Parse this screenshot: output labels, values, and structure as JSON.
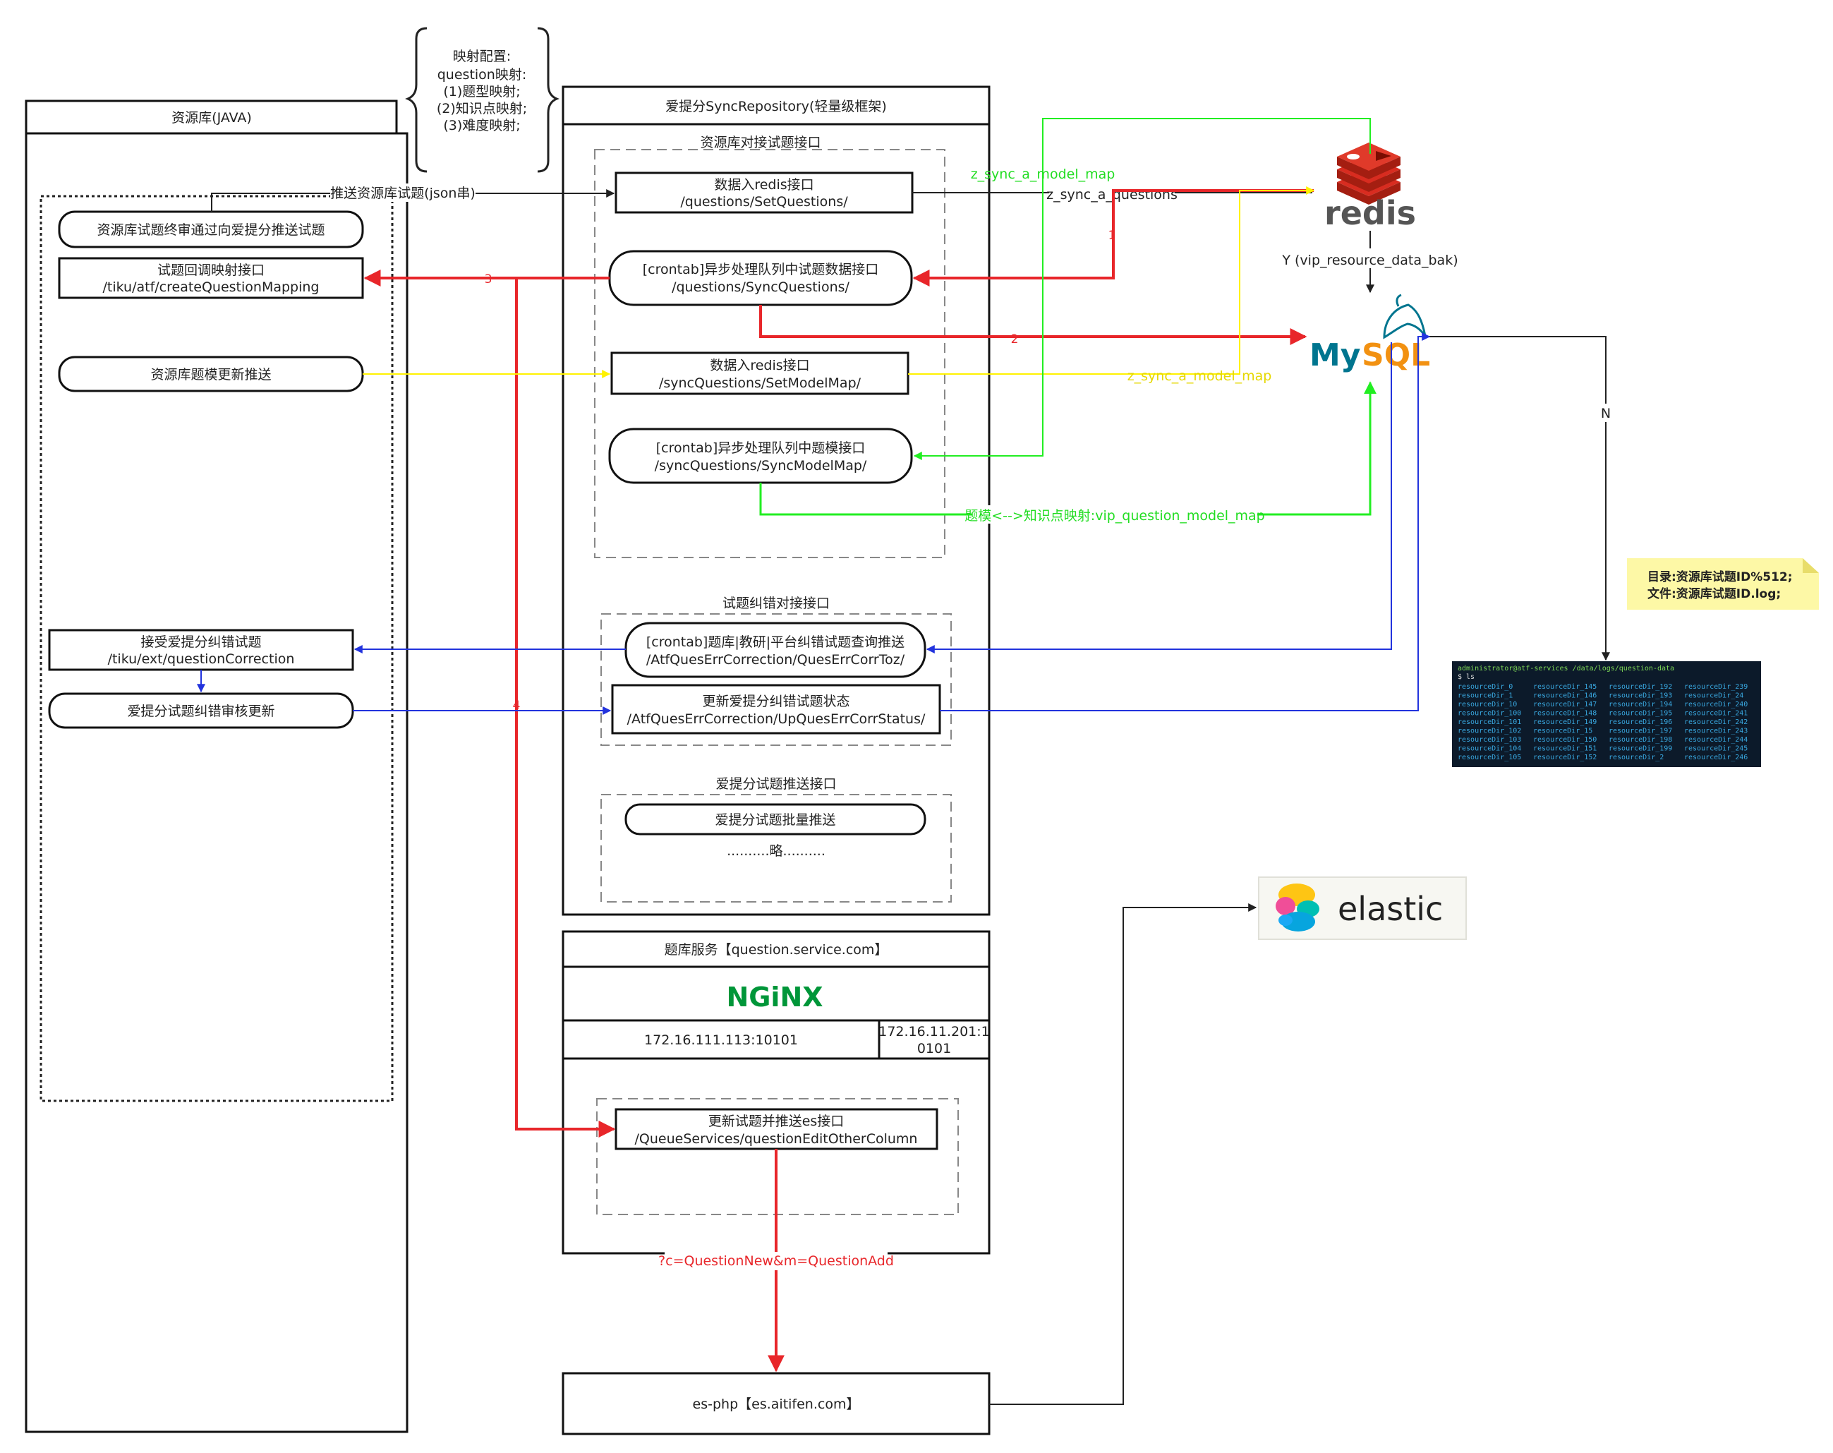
{
  "left_panel": {
    "title": "资源库(JAVA)"
  },
  "mapping_note": {
    "title": "映射配置:",
    "lines": [
      "question映射:",
      "(1)题型映射;",
      "(2)知识点映射;",
      "(3)难度映射;"
    ]
  },
  "left_nodes": {
    "review_push": "资源库试题终审通过向爱提分推送试题",
    "callback_l1": "试题回调映射接口",
    "callback_l2": "/tiku/atf/createQuestionMapping",
    "template_push": "资源库题模更新推送",
    "accept_l1": "接受爱提分纠错试题",
    "accept_l2": "/tiku/ext/questionCorrection",
    "audit_update": "爱提分试题纠错审核更新"
  },
  "sync_repo": {
    "title": "爱提分SyncRepository(轻量级框架)",
    "group1_title": "资源库对接试题接口",
    "n1_l1": "数据入redis接口",
    "n1_l2": "/questions/SetQuestions/",
    "n2_l1": "[crontab]异步处理队列中试题数据接口",
    "n2_l2": "/questions/SyncQuestions/",
    "n3_l1": "数据入redis接口",
    "n3_l2": "/syncQuestions/SetModelMap/",
    "n4_l1": "[crontab]异步处理队列中题模接口",
    "n4_l2": "/syncQuestions/SyncModelMap/",
    "group2_title": "试题纠错对接接口",
    "n5_l1": "[crontab]题库|教研|平台纠错试题查询推送",
    "n5_l2": "/AtfQuesErrCorrection/QuesErrCorrToz/",
    "n6_l1": "更新爱提分纠错试题状态",
    "n6_l2": "/AtfQuesErrCorrection/UpQuesErrCorrStatus/",
    "group3_title": "爱提分试题推送接口",
    "n7": "爱提分试题批量推送",
    "omitted": "..........略.........."
  },
  "qservice": {
    "title": "题库服务【question.service.com】",
    "nginx": "NGiNX",
    "ip1": "172.16.111.113:10101",
    "ip2_l1": "172.16.11.201:1",
    "ip2_l2": "0101",
    "n8_l1": "更新试题并推送es接口",
    "n8_l2": "/QueueServices/questionEditOtherColumn"
  },
  "es_php": {
    "label": "es-php【es.aitifen.com】"
  },
  "labels": {
    "push_json": "推送资源库试题(json串)",
    "z_sync_model_map": "z_sync_a_model_map",
    "z_sync_questions": "z_sync_a_questions",
    "n1": "1",
    "n2": "2",
    "n3": "3",
    "n4": "4",
    "y_bak": "Y (vip_resource_data_bak)",
    "n_label": "N",
    "z_sync_model_map_2": "z_sync_a_model_map",
    "model_kp": "题模<-->知识点映射:vip_question_model_map",
    "query": "?c=QuestionNew&m=QuestionAdd"
  },
  "logos": {
    "redis": "redis",
    "mysql_a": "My",
    "mysql_b": "SQL",
    "elastic": "elastic"
  },
  "sticky_note": {
    "line1": "目录:资源库试题ID%512;",
    "line2": "文件:资源库试题ID.log;"
  },
  "terminal": {
    "header": "administrator@atf-services /data/logs/question-data",
    "prompt": "$ ls",
    "rows": [
      [
        "resourceDir_0",
        "resourceDir_145",
        "resourceDir_192",
        "resourceDir_239"
      ],
      [
        "resourceDir_1",
        "resourceDir_146",
        "resourceDir_193",
        "resourceDir_24"
      ],
      [
        "resourceDir_10",
        "resourceDir_147",
        "resourceDir_194",
        "resourceDir_240"
      ],
      [
        "resourceDir_100",
        "resourceDir_148",
        "resourceDir_195",
        "resourceDir_241"
      ],
      [
        "resourceDir_101",
        "resourceDir_149",
        "resourceDir_196",
        "resourceDir_242"
      ],
      [
        "resourceDir_102",
        "resourceDir_15",
        "resourceDir_197",
        "resourceDir_243"
      ],
      [
        "resourceDir_103",
        "resourceDir_150",
        "resourceDir_198",
        "resourceDir_244"
      ],
      [
        "resourceDir_104",
        "resourceDir_151",
        "resourceDir_199",
        "resourceDir_245"
      ],
      [
        "resourceDir_105",
        "resourceDir_152",
        "resourceDir_2",
        "resourceDir_246"
      ]
    ]
  },
  "colors": {
    "red": "#e8262a",
    "yellow": "#fff200",
    "green": "#22ee22",
    "blue": "#2233dd",
    "black": "#222222",
    "redis_red": "#d82c20",
    "mysql_blue": "#00758f",
    "mysql_orange": "#f29111",
    "nginx_green": "#009639",
    "sticky": "#fdf8a6",
    "terminal_bg": "#0c1a2a"
  }
}
